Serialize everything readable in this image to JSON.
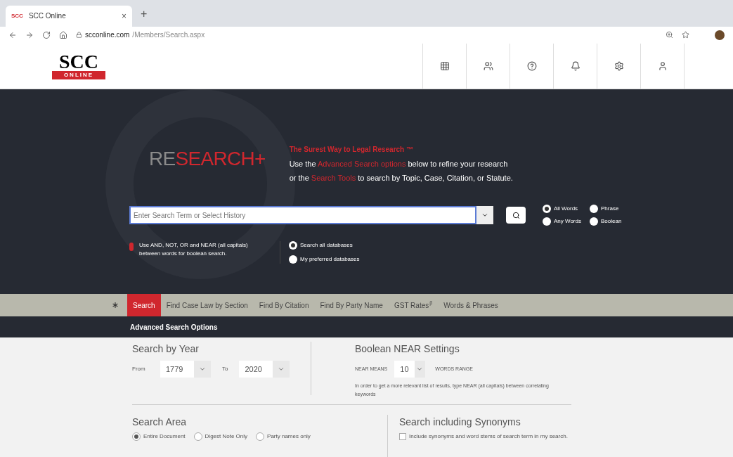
{
  "browser": {
    "favicon": "SCC",
    "tab_title": "SCC Online",
    "tab_close": "×",
    "new_tab": "+",
    "url_host": "scconline.com",
    "url_path": "/Members/Search.aspx"
  },
  "header": {
    "logo_top": "SCC",
    "logo_bottom": "ONLINE"
  },
  "hero": {
    "brand_grey": "RE",
    "brand_red": "SEARCH+",
    "tagline": "The Surest Way to Legal Research ™",
    "line1": [
      {
        "kind": "plain",
        "text": "Use the "
      },
      {
        "kind": "link",
        "text": "Advanced Search options"
      },
      {
        "kind": "plain",
        "text": " below to refine your research"
      }
    ],
    "line2": [
      {
        "kind": "plain",
        "text": "or the "
      },
      {
        "kind": "link",
        "text": "Search Tools"
      },
      {
        "kind": "plain",
        "text": " to search by Topic, Case, Citation, or Statute."
      }
    ],
    "search_placeholder": "Enter Search Term or Select History",
    "match_modes": [
      {
        "label": "All Words",
        "selected": true
      },
      {
        "label": "Phrase",
        "selected": false
      },
      {
        "label": "Any Words",
        "selected": false
      },
      {
        "label": "Boolean",
        "selected": false
      }
    ],
    "hint": "Use AND, NOT, OR and NEAR (all capitals) between words for boolean search.",
    "databases": [
      {
        "label": "Search all databases",
        "selected": true
      },
      {
        "label": "My preferred databases",
        "selected": false
      }
    ]
  },
  "nav_tabs": [
    {
      "label": "Search",
      "selected": true
    },
    {
      "label": "Find Case Law by Section",
      "selected": false
    },
    {
      "label": "Find By Citation",
      "selected": false
    },
    {
      "label": "Find By Party Name",
      "selected": false
    },
    {
      "label": "GST Rates",
      "sup": "β",
      "selected": false
    },
    {
      "label": "Words & Phrases",
      "selected": false
    }
  ],
  "advanced_title": "Advanced Search Options",
  "year": {
    "title": "Search by Year",
    "from_label": "From",
    "from": "1779",
    "to_label": "To",
    "to": "2020"
  },
  "near": {
    "title": "Boolean NEAR Settings",
    "label": "NEAR MEANS",
    "value": "10",
    "suffix": "WORDS RANGE",
    "note": "In order to get a more relevant list of results, type NEAR (all capitals) between correlating keywords"
  },
  "area": {
    "title": "Search Area",
    "options": [
      {
        "label": "Entire Document",
        "selected": true
      },
      {
        "label": "Digest Note Only",
        "selected": false
      },
      {
        "label": "Party names only",
        "selected": false
      }
    ]
  },
  "synonyms": {
    "title": "Search including Synonyms",
    "label": "Include synonyms and word stems of search term in my search.",
    "checked": false
  }
}
